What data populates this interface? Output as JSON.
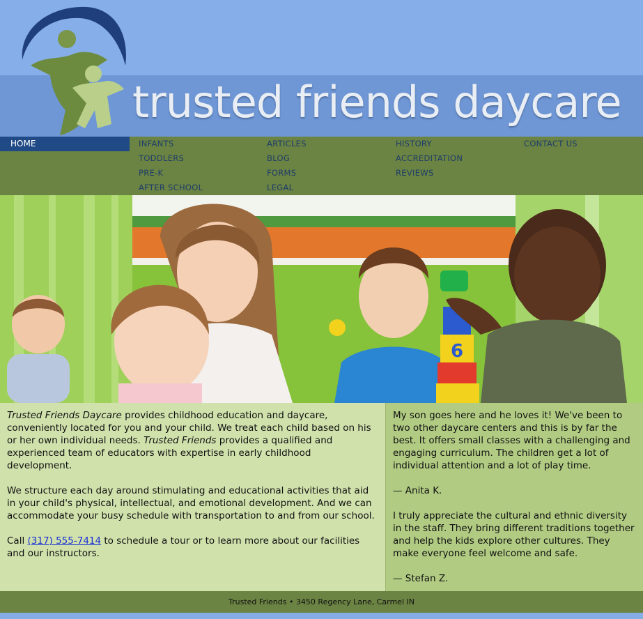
{
  "header": {
    "site_title": "trusted friends daycare"
  },
  "nav": {
    "home": "HOME",
    "col1": [
      "INFANTS",
      "TODDLERS",
      "PRE-K",
      "AFTER SCHOOL"
    ],
    "col2": [
      "ARTICLES",
      "BLOG",
      "FORMS",
      "LEGAL"
    ],
    "col3": [
      "HISTORY",
      "ACCREDITATION",
      "REVIEWS"
    ],
    "col4": [
      "CONTACT US"
    ]
  },
  "intro": {
    "p1_brand": "Trusted Friends Daycare",
    "p1_a": " provides childhood education and daycare, conveniently located for you and your child. We treat each child based on his or her own individual needs. ",
    "p1_brand2": "Trusted Friends",
    "p1_b": " provides a qualified and experienced team of educators with expertise in early childhood development.",
    "p2": "We structure each day around stimulating and educational activities that aid in your child's physical, intellectual, and emotional development. And we can accommodate your busy schedule with transportation to and from our school.",
    "p3_a": "Call ",
    "phone": "(317) 555-7414",
    "p3_b": " to schedule a tour or to learn more about our facilities and our instructors."
  },
  "testimonials": [
    {
      "quote": "My son goes here and he loves it! We've been to two other daycare centers and this is by far the best. It offers small classes with a challenging and engaging curriculum. The children get a lot of individual attention and a lot of play time.",
      "author": "— Anita K."
    },
    {
      "quote": "I truly appreciate the cultural and ethnic diversity in the staff. They bring different traditions together and help the kids explore other cultures. They make everyone feel welcome and safe.",
      "author": "— Stefan Z."
    }
  ],
  "footer": {
    "text": "Trusted Friends • 3450 Regency Lane, Carmel IN"
  },
  "colors": {
    "sky_blue": "#86ade6",
    "nav_green": "#6b8343",
    "home_blue": "#1f4a86",
    "left_panel": "#d0e1ac",
    "right_panel": "#b1cb83"
  },
  "icons": {
    "logo": "two-people-under-arc-logo-icon"
  }
}
